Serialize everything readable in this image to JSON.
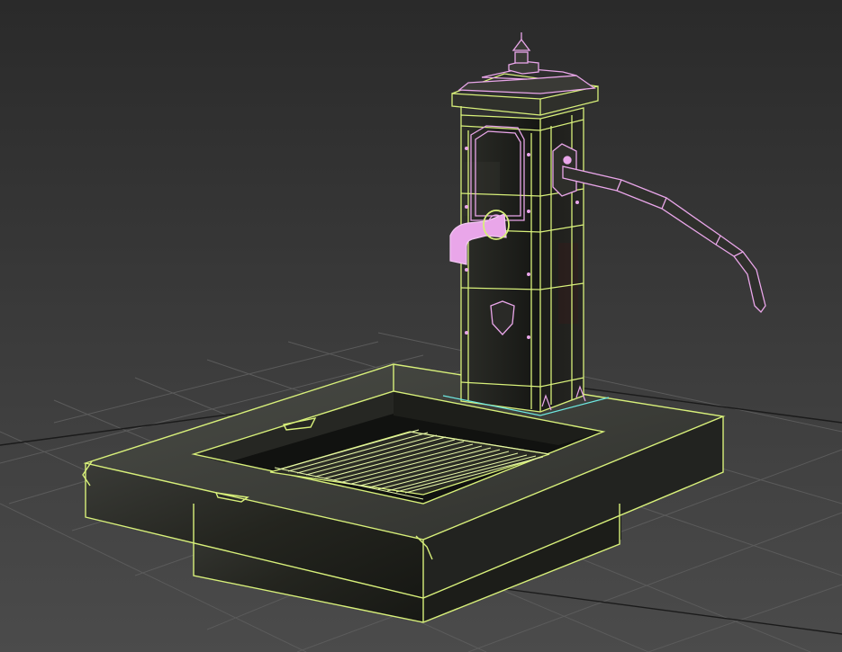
{
  "viewport": {
    "background_top": "#2b2b2b",
    "background_bottom": "#4a4a4a",
    "grid_color": "#5a5a5a",
    "grid_axis_color": "#1e1e1e"
  },
  "scene": {
    "objects": [
      {
        "name": "water-pump-body",
        "selected": true,
        "wire_color": "#d8f07a"
      },
      {
        "name": "pump-cap",
        "selected": false,
        "wire_color": "#e9a6e9"
      },
      {
        "name": "pump-handle",
        "selected": false,
        "wire_color": "#e9a6e9"
      },
      {
        "name": "pump-spout",
        "selected": false,
        "wire_color": "#e9a6e9"
      },
      {
        "name": "basin-trough",
        "selected": true,
        "wire_color": "#d8f07a"
      },
      {
        "name": "basin-grate",
        "selected": true,
        "wire_color": "#d8f07a"
      }
    ]
  }
}
